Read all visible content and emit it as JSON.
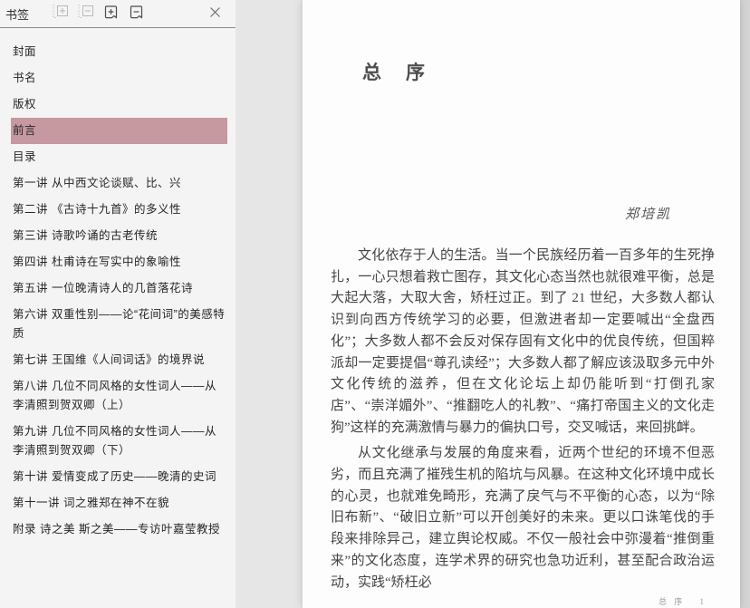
{
  "sidebar": {
    "title": "书签",
    "active_color": "#c6989f",
    "items": [
      {
        "label": "封面",
        "active": false
      },
      {
        "label": "书名",
        "active": false
      },
      {
        "label": "版权",
        "active": false
      },
      {
        "label": "前言",
        "active": true
      },
      {
        "label": "目录",
        "active": false
      },
      {
        "label": "第一讲  从中西文论谈赋、比、兴",
        "active": false
      },
      {
        "label": "第二讲  《古诗十九首》的多义性",
        "active": false
      },
      {
        "label": "第三讲  诗歌吟诵的古老传统",
        "active": false
      },
      {
        "label": "第四讲  杜甫诗在写实中的象喻性",
        "active": false
      },
      {
        "label": "第五讲  一位晚清诗人的几首落花诗",
        "active": false
      },
      {
        "label": "第六讲  双重性别——论“花间词”的美感特质",
        "active": false
      },
      {
        "label": "第七讲  王国维《人间词话》的境界说",
        "active": false
      },
      {
        "label": "第八讲  几位不同风格的女性词人——从李清照到贺双卿（上）",
        "active": false
      },
      {
        "label": "第九讲  几位不同风格的女性词人——从李清照到贺双卿（下）",
        "active": false
      },
      {
        "label": "第十讲  爱情变成了历史——晚清的史词",
        "active": false
      },
      {
        "label": "第十一讲  词之雅郑在神不在貌",
        "active": false
      },
      {
        "label": "附录  诗之美 斯之美——专访叶嘉莹教授",
        "active": false
      }
    ]
  },
  "page": {
    "title": "总　序",
    "author": "郑培凯",
    "paragraphs": [
      "文化依存于人的生活。当一个民族经历着一百多年的生死挣扎，一心只想着救亡图存，其文化心态当然也就很难平衡，总是大起大落，大取大舍，矫枉过正。到了 21 世纪，大多数人都认识到向西方传统学习的必要，但激进者却一定要喊出“全盘西化”；大多数人都不会反对保存固有文化中的优良传统，但国粹派却一定要提倡“尊孔读经”；大多数人都了解应该汲取多元中外文化传统的滋养，但在文化论坛上却仍能听到“打倒孔家店”、“崇洋媚外”、“推翻吃人的礼教”、“痛打帝国主义的文化走狗”这样的充满激情与暴力的偏执口号，交叉喊话，来回挑衅。",
      "从文化继承与发展的角度来看，近两个世纪的环境不但恶劣，而且充满了摧残生机的陷坑与风暴。在这种文化环境中成长的心灵，也就难免畸形，充满了戾气与不平衡的心态，以为“除旧布新”、“破旧立新”可以开创美好的未来。更以口诛笔伐的手段来排除异己，建立舆论权威。不仅一般社会中弥漫着“推倒重来”的文化态度，连学术界的研究也急功近利，甚至配合政治运动，实践“矫枉必"
    ],
    "footer": {
      "label": "总 序",
      "page_number": "1"
    }
  }
}
